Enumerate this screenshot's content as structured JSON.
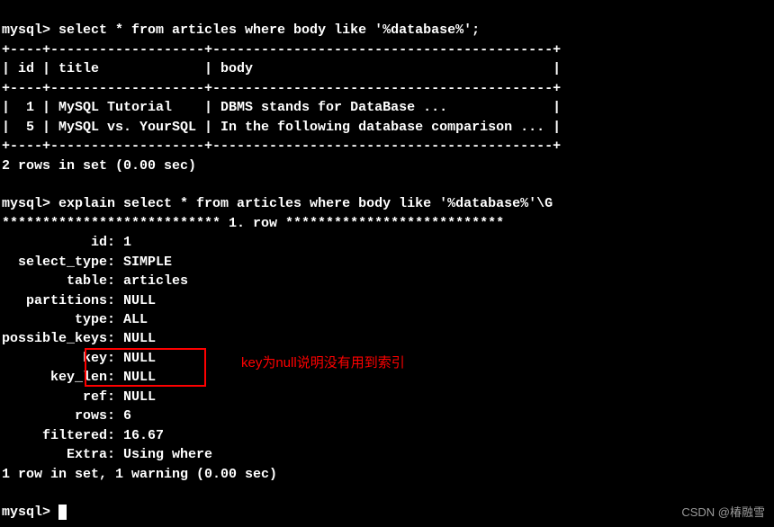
{
  "query1": {
    "prompt": "mysql> ",
    "command": "select * from articles where body like '%database%';",
    "table_border_top": "+----+-------------------+------------------------------------------+",
    "table_header": "| id | title             | body                                     |",
    "table_border_mid": "+----+-------------------+------------------------------------------+",
    "table_row1": "|  1 | MySQL Tutorial    | DBMS stands for DataBase ...             |",
    "table_row2": "|  5 | MySQL vs. YourSQL | In the following database comparison ... |",
    "table_border_bot": "+----+-------------------+------------------------------------------+",
    "result_summary": "2 rows in set (0.00 sec)"
  },
  "query2": {
    "prompt": "mysql> ",
    "command": "explain select * from articles where body like '%database%'\\G",
    "row_header": "*************************** 1. row ***************************",
    "fields": {
      "id": "           id: 1",
      "select_type": "  select_type: SIMPLE",
      "table": "        table: articles",
      "partitions": "   partitions: NULL",
      "type": "         type: ALL",
      "possible_keys": "possible_keys: NULL",
      "key": "          key: NULL",
      "key_len": "      key_len: NULL",
      "ref": "          ref: NULL",
      "rows": "         rows: 6",
      "filtered": "     filtered: 16.67",
      "extra": "        Extra: Using where"
    },
    "result_summary": "1 row in set, 1 warning (0.00 sec)"
  },
  "prompt3": "mysql> ",
  "annotation": {
    "text": "key为null说明没有用到索引"
  },
  "watermark": "CSDN @椿融雪"
}
